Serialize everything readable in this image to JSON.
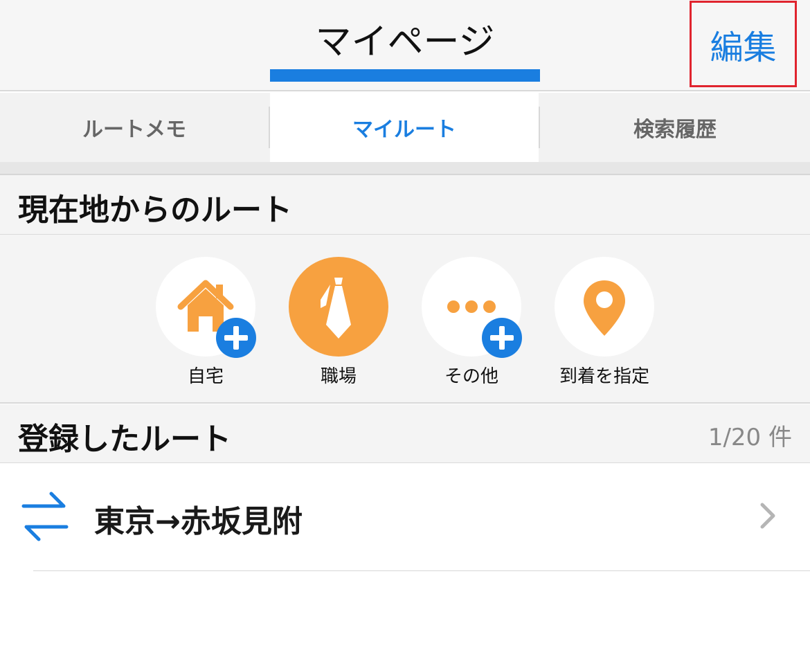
{
  "navbar": {
    "title": "マイページ",
    "edit_label": "編集"
  },
  "tabs": [
    {
      "label": "ルートメモ"
    },
    {
      "label": "マイルート"
    },
    {
      "label": "検索履歴"
    }
  ],
  "active_tab": "マイルート",
  "current_location_section": {
    "title": "現在地からのルート"
  },
  "quick_destinations": [
    {
      "label": "自宅",
      "icon": "home-icon"
    },
    {
      "label": "職場",
      "icon": "tie-icon"
    },
    {
      "label": "その他",
      "icon": "more-dots-icon"
    },
    {
      "label": "到着を指定",
      "icon": "map-pin-icon"
    }
  ],
  "saved_section": {
    "title": "登録したルート",
    "count": "1/20 件"
  },
  "saved_routes": [
    {
      "label": "東京→赤坂見附",
      "icon": "swap-arrows-icon"
    }
  ],
  "colors": {
    "accent": "#1a7ee0",
    "orange": "#f7a140",
    "highlight_border": "#e0242e"
  }
}
